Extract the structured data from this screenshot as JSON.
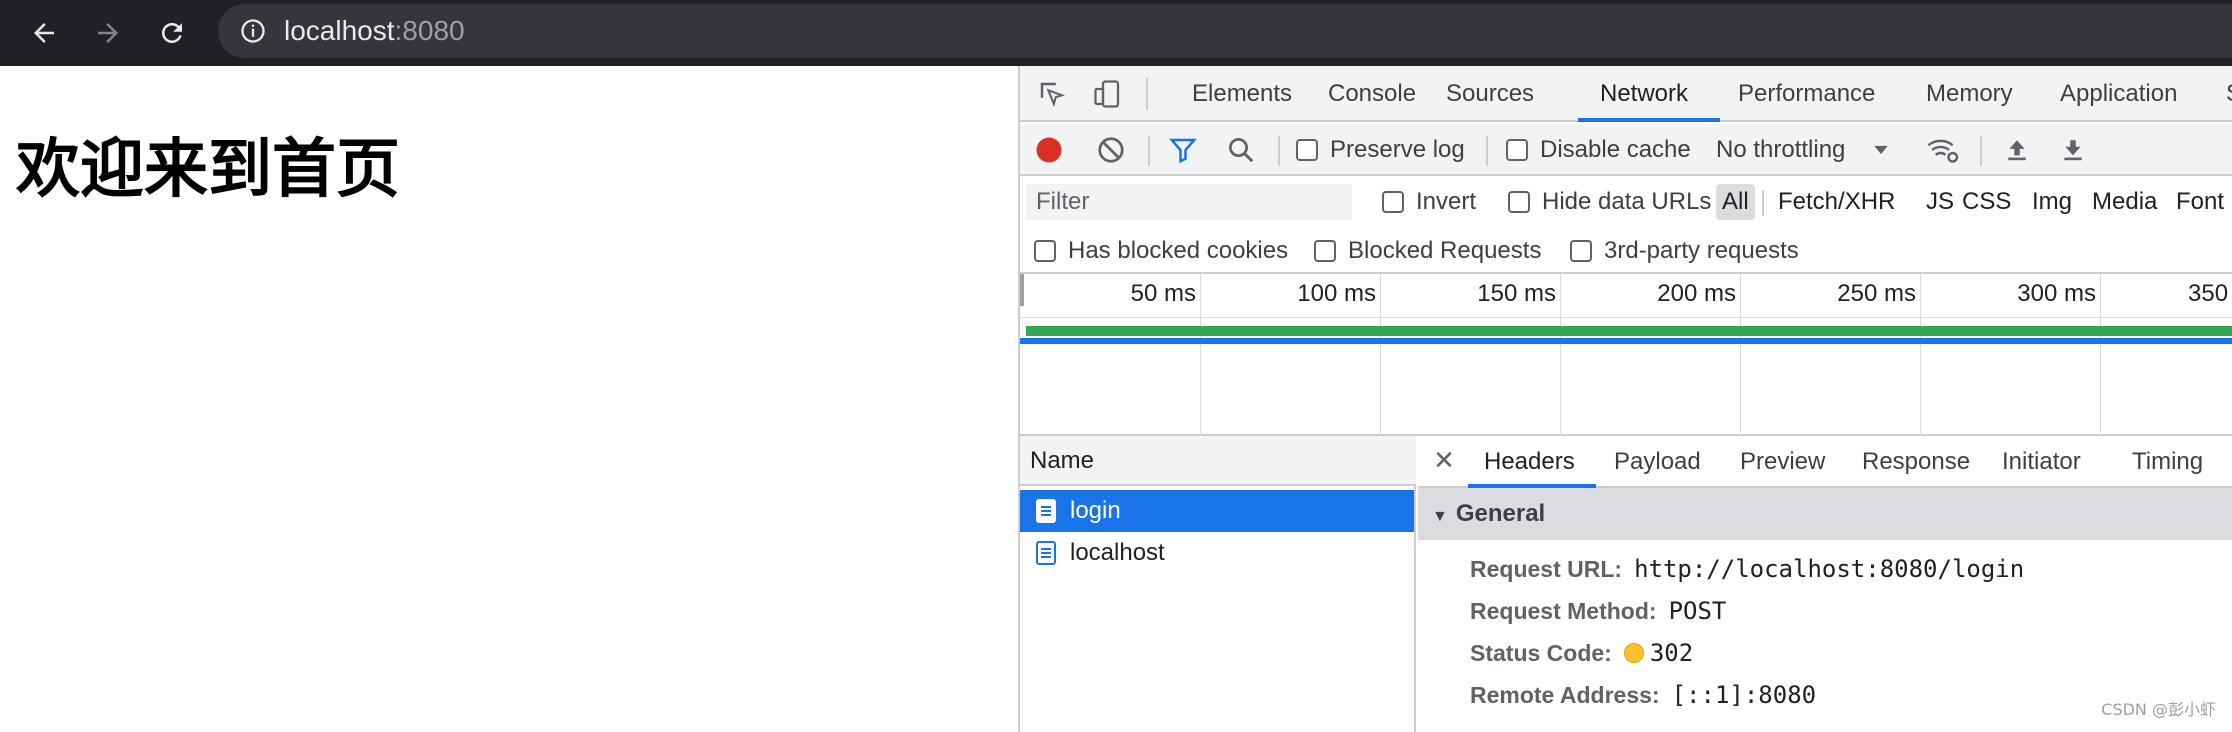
{
  "browser": {
    "url_host": "localhost",
    "url_port": ":8080"
  },
  "page": {
    "heading": "欢迎来到首页"
  },
  "devtools": {
    "tabs": [
      "Elements",
      "Console",
      "Sources",
      "Network",
      "Performance",
      "Memory",
      "Application",
      "S"
    ],
    "active_tab": "Network",
    "toolbar": {
      "preserve_log": "Preserve log",
      "disable_cache": "Disable cache",
      "throttling": "No throttling"
    },
    "filter": {
      "placeholder": "Filter",
      "invert": "Invert",
      "hide_data_urls": "Hide data URLs",
      "types": [
        "All",
        "Fetch/XHR",
        "JS",
        "CSS",
        "Img",
        "Media",
        "Font"
      ]
    },
    "blocked": {
      "has_blocked_cookies": "Has blocked cookies",
      "blocked_requests": "Blocked Requests",
      "third_party": "3rd-party requests"
    },
    "timeline_labels": [
      "50 ms",
      "100 ms",
      "150 ms",
      "200 ms",
      "250 ms",
      "300 ms",
      "350"
    ],
    "requests": {
      "header": "Name",
      "items": [
        "login",
        "localhost"
      ],
      "selected": "login"
    },
    "detail": {
      "tabs": [
        "Headers",
        "Payload",
        "Preview",
        "Response",
        "Initiator",
        "Timing"
      ],
      "active_tab": "Headers",
      "section": "General",
      "fields": [
        {
          "key": "Request URL:",
          "value": "http://localhost:8080/login"
        },
        {
          "key": "Request Method:",
          "value": "POST"
        },
        {
          "key": "Status Code:",
          "value": "302"
        },
        {
          "key": "Remote Address:",
          "value": "[::1]:8080"
        }
      ]
    }
  },
  "watermark": "CSDN @彭小虾",
  "colors": {
    "accent": "#1a73e8",
    "record": "#d93025",
    "status_302": "#f9c22e",
    "timeline_green": "#34a853"
  }
}
